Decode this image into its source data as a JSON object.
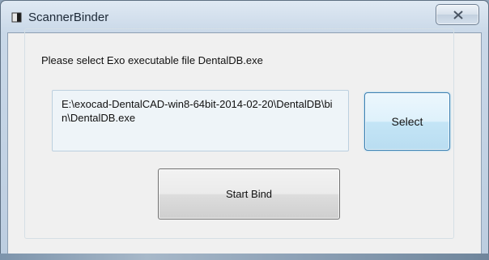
{
  "window": {
    "title": "ScannerBinder",
    "icon": "scanner-app-icon",
    "close_icon": "close-x-icon"
  },
  "group": {
    "legend": "Please select Exo executable file DentalDB.exe"
  },
  "path_field": {
    "value": "E:\\exocad-DentalCAD-win8-64bit-2014-02-20\\DentalDB\\bin\\DentalDB.exe"
  },
  "buttons": {
    "select_label": "Select",
    "start_bind_label": "Start Bind"
  },
  "colors": {
    "select_border": "#3c7fb1",
    "client_bg": "#f0f0f0"
  }
}
